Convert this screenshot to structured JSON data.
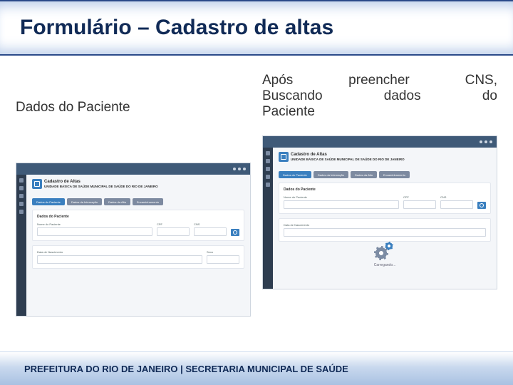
{
  "title": "Formulário – Cadastro de altas",
  "left": {
    "caption": "Dados do Paciente",
    "screenshot": {
      "page_heading": "Cadastro de Altas",
      "page_sub": "UNIDADE BÁSICA DE SAÚDE MUNICIPAL DE SAÚDE DO RIO DE JANEIRO",
      "tabs": [
        "Dados do Paciente",
        "Dados da Internação",
        "Dados da Alta",
        "Encaminhamento"
      ],
      "card1_title": "Dados do Paciente",
      "field_nome": "Nome do Paciente",
      "field_cpf": "CPF",
      "field_cns": "CNS",
      "field_dn": "Data de Nascimento",
      "field_sexo": "Sexo"
    }
  },
  "right": {
    "caption_l1a": "Após",
    "caption_l1b": "preencher",
    "caption_l1c": "CNS,",
    "caption_l2a": "Buscando",
    "caption_l2b": "dados",
    "caption_l2c": "do",
    "caption_l3": "Paciente",
    "screenshot": {
      "page_heading": "Cadastro de Altas",
      "page_sub": "UNIDADE BÁSICA DE SAÚDE MUNICIPAL DE SAÚDE DO RIO DE JANEIRO",
      "tabs": [
        "Dados do Paciente",
        "Dados da Internação",
        "Dados da Alta",
        "Encaminhamento"
      ],
      "card1_title": "Dados do Paciente",
      "field_nome": "Nome do Paciente",
      "field_cpf": "CPF",
      "field_cns": "CNS",
      "field_dn": "Data de Nascimento",
      "loading": "Carregando..."
    }
  },
  "footer": "PREFEITURA DO RIO DE JANEIRO | SECRETARIA MUNICIPAL DE SAÚDE"
}
